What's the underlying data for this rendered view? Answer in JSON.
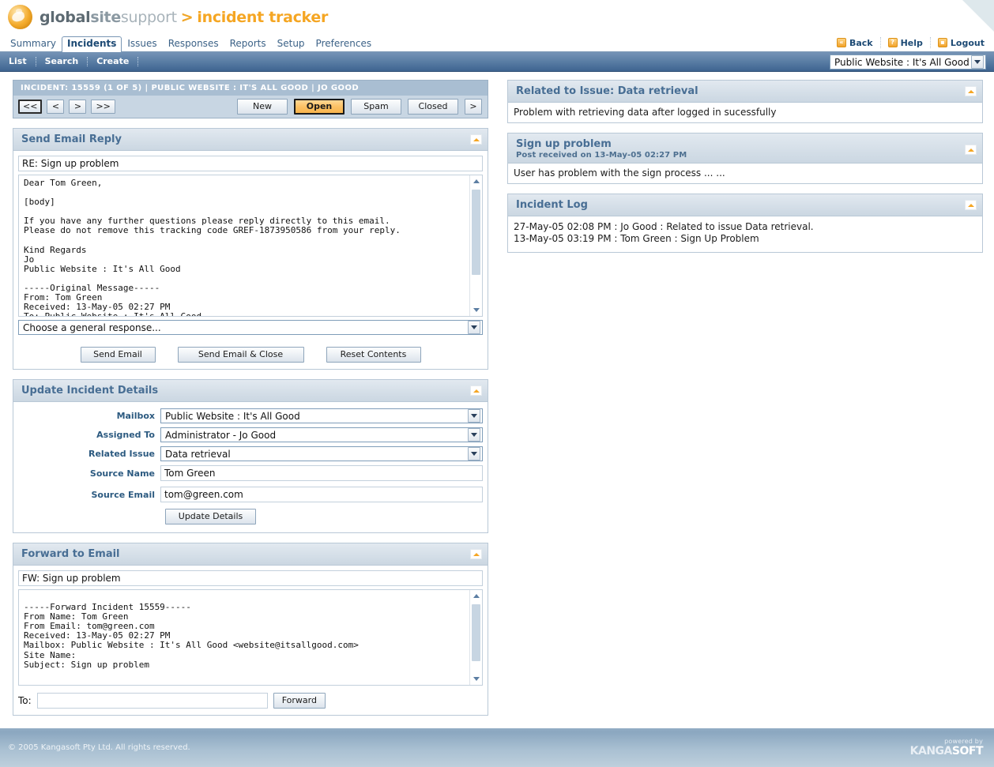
{
  "brand": {
    "logo_icon": "globe-icon",
    "global": "global",
    "site": "site",
    "support": "support",
    "separator": ">",
    "product": "incident tracker"
  },
  "nav": {
    "tabs": [
      {
        "label": "Summary",
        "active": false
      },
      {
        "label": "Incidents",
        "active": true
      },
      {
        "label": "Issues",
        "active": false
      },
      {
        "label": "Responses",
        "active": false
      },
      {
        "label": "Reports",
        "active": false
      },
      {
        "label": "Setup",
        "active": false
      },
      {
        "label": "Preferences",
        "active": false
      }
    ],
    "links": [
      {
        "label": "Back",
        "icon": "back-icon",
        "glyph": "«"
      },
      {
        "label": "Help",
        "icon": "help-icon",
        "glyph": "?"
      },
      {
        "label": "Logout",
        "icon": "lock-icon",
        "glyph": "▪"
      }
    ]
  },
  "subnav": {
    "items": [
      {
        "label": "List"
      },
      {
        "label": "Search"
      },
      {
        "label": "Create"
      }
    ],
    "mailbox_selected": "Public Website : It's All Good"
  },
  "incident": {
    "header": "INCIDENT: 15559 (1 OF 5) | PUBLIC WEBSITE : IT'S ALL GOOD | JO GOOD",
    "pager": [
      {
        "label": "<<",
        "focused": true
      },
      {
        "label": "<",
        "focused": false
      },
      {
        "label": ">",
        "focused": false
      },
      {
        "label": ">>",
        "focused": false
      }
    ],
    "statuses": [
      {
        "label": "New",
        "active": false
      },
      {
        "label": "Open",
        "active": true
      },
      {
        "label": "Spam",
        "active": false
      },
      {
        "label": "Closed",
        "active": false
      },
      {
        "label": ">",
        "active": false
      }
    ]
  },
  "send_email_reply": {
    "title": "Send Email Reply",
    "collapse_icon": "chevron-up-icon",
    "subject": "RE: Sign up problem",
    "body": "Dear Tom Green,\n\n[body]\n\nIf you have any further questions please reply directly to this email.\nPlease do not remove this tracking code GREF-1873950586 from your reply.\n\nKind Regards\nJo\nPublic Website : It's All Good\n\n-----Original Message-----\nFrom: Tom Green\nReceived: 13-May-05 02:27 PM\nTo: Public Website : It's All Good",
    "response_select": "Choose a general response...",
    "buttons": [
      {
        "label": "Send Email"
      },
      {
        "label": "Send Email & Close"
      },
      {
        "label": "Reset Contents"
      }
    ]
  },
  "update_incident_details": {
    "title": "Update Incident Details",
    "collapse_icon": "chevron-up-icon",
    "fields": [
      {
        "label": "Mailbox",
        "value": "Public Website : It's All Good",
        "type": "select"
      },
      {
        "label": "Assigned To",
        "value": "Administrator - Jo Good",
        "type": "select"
      },
      {
        "label": "Related Issue",
        "value": "Data retrieval",
        "type": "select"
      },
      {
        "label": "Source Name",
        "value": "Tom Green",
        "type": "text"
      },
      {
        "label": "Source Email",
        "value": "tom@green.com",
        "type": "text"
      }
    ],
    "submit_label": "Update Details"
  },
  "forward_to_email": {
    "title": "Forward to Email",
    "collapse_icon": "chevron-up-icon",
    "subject": "FW: Sign up problem",
    "body": "\n-----Forward Incident 15559-----\nFrom Name: Tom Green\nFrom Email: tom@green.com\nReceived: 13-May-05 02:27 PM\nMailbox: Public Website : It's All Good <website@itsallgood.com>\nSite Name:\nSubject: Sign up problem",
    "to_label": "To:",
    "to_value": "",
    "forward_label": "Forward"
  },
  "related_issue": {
    "title": "Related to Issue: Data retrieval",
    "collapse_icon": "chevron-up-icon",
    "text": "Problem with retrieving data after logged in sucessfully"
  },
  "post": {
    "title": "Sign up problem",
    "subtitle": "Post received on 13-May-05 02:27 PM",
    "collapse_icon": "chevron-up-icon",
    "text": "User has problem with the sign process ... ..."
  },
  "incident_log": {
    "title": "Incident Log",
    "collapse_icon": "chevron-up-icon",
    "entries": [
      "27-May-05 02:08 PM : Jo Good : Related to issue Data retrieval.",
      "13-May-05 03:19 PM : Tom Green : Sign Up Problem"
    ]
  },
  "footer": {
    "copyright": "© 2005 Kangasoft Pty Ltd. All rights reserved.",
    "powered_by": "powered by",
    "vendor_1": "KANGA",
    "vendor_2": "SOFT"
  }
}
